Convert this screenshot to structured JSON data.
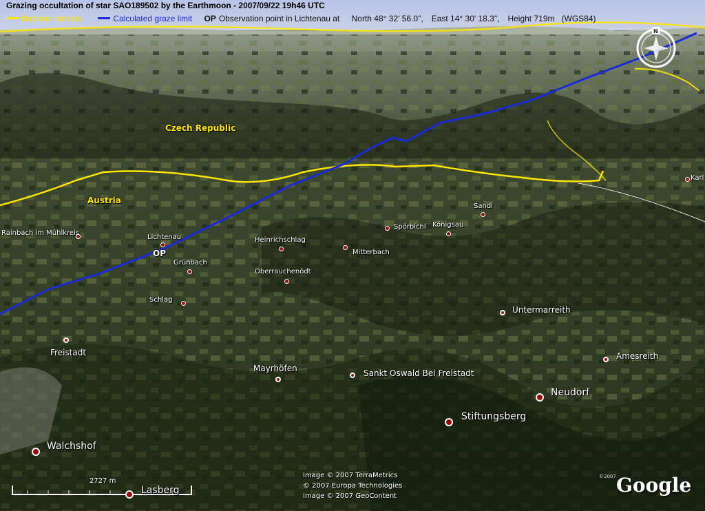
{
  "header": {
    "title": "Grazing occultation of star SAO189502 by the Earthmoon - 2007/09/22 19h46 UTC",
    "legend_borders": "National borders",
    "legend_graze": "Calculated graze limit",
    "op_key": "OP",
    "op_text": "Observation point in Lichtenau at",
    "north": "North 48° 32' 56.0\",",
    "east": "East 14° 30' 18.3\",",
    "height": "Height  719m",
    "datum": "(WGS84)"
  },
  "colors": {
    "border": "#ffe600",
    "graze": "#1a2bd6",
    "place_dot": "#9b0a0a"
  },
  "countries": {
    "czech": "Czech Republic",
    "austria": "Austria"
  },
  "op_marker": "OP",
  "places": {
    "rainbach": "Rainbach im Mühlkreis",
    "lichtenau": "Lichtenau",
    "gruenbach": "Grünbach",
    "heinrichschlag": "Heinrichschlag",
    "mitterbach": "Mitterbach",
    "oberrauchenoed": "Oberrauchenödt",
    "schlag": "Schlag",
    "freistadt": "Freistadt",
    "mayrhoefen": "Mayrhöfen",
    "sanktoswald": "Sankt Oswald Bei Freistadt",
    "spoerbichl": "Spörbichl",
    "koenigsau": "Königsau",
    "sandl": "Sandl",
    "untermarreith": "Untermarreith",
    "amesreith": "Amesreith",
    "neudorf": "Neudorf",
    "stiftungsberg": "Stiftungsberg",
    "walchshof": "Walchshof",
    "lasberg": "Lasberg",
    "karl": "Karl"
  },
  "scale_label": "2727 m",
  "credits": [
    "Image © 2007 TerraMetrics",
    "© 2007 Europa Technologies",
    "Image © 2007 GeoContent"
  ],
  "logo": "Google",
  "logo_copyright": "©2007",
  "compass_north": "N"
}
